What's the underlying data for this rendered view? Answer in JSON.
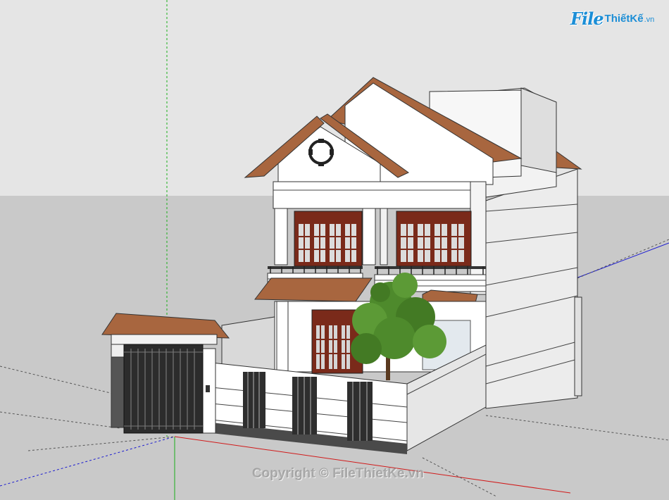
{
  "brand": {
    "logo_file": "File",
    "logo_rest": "ThiếtKế",
    "logo_tld": ".vn"
  },
  "watermark": {
    "text": "Copyright © FileThietKe.vn"
  },
  "colors": {
    "sky": "#e4e4e4",
    "ground": "#c8c8c8",
    "wall": "#ffffff",
    "wall_shade": "#ececec",
    "roof": "#a8663f",
    "wood": "#7a2a1a",
    "glass": "#e8e8e8",
    "dark_base": "#4a4a4a",
    "tree": "#4e8a2c",
    "axis_red": "#d11a1a",
    "axis_green": "#18b018",
    "axis_blue": "#1a1ad1"
  }
}
